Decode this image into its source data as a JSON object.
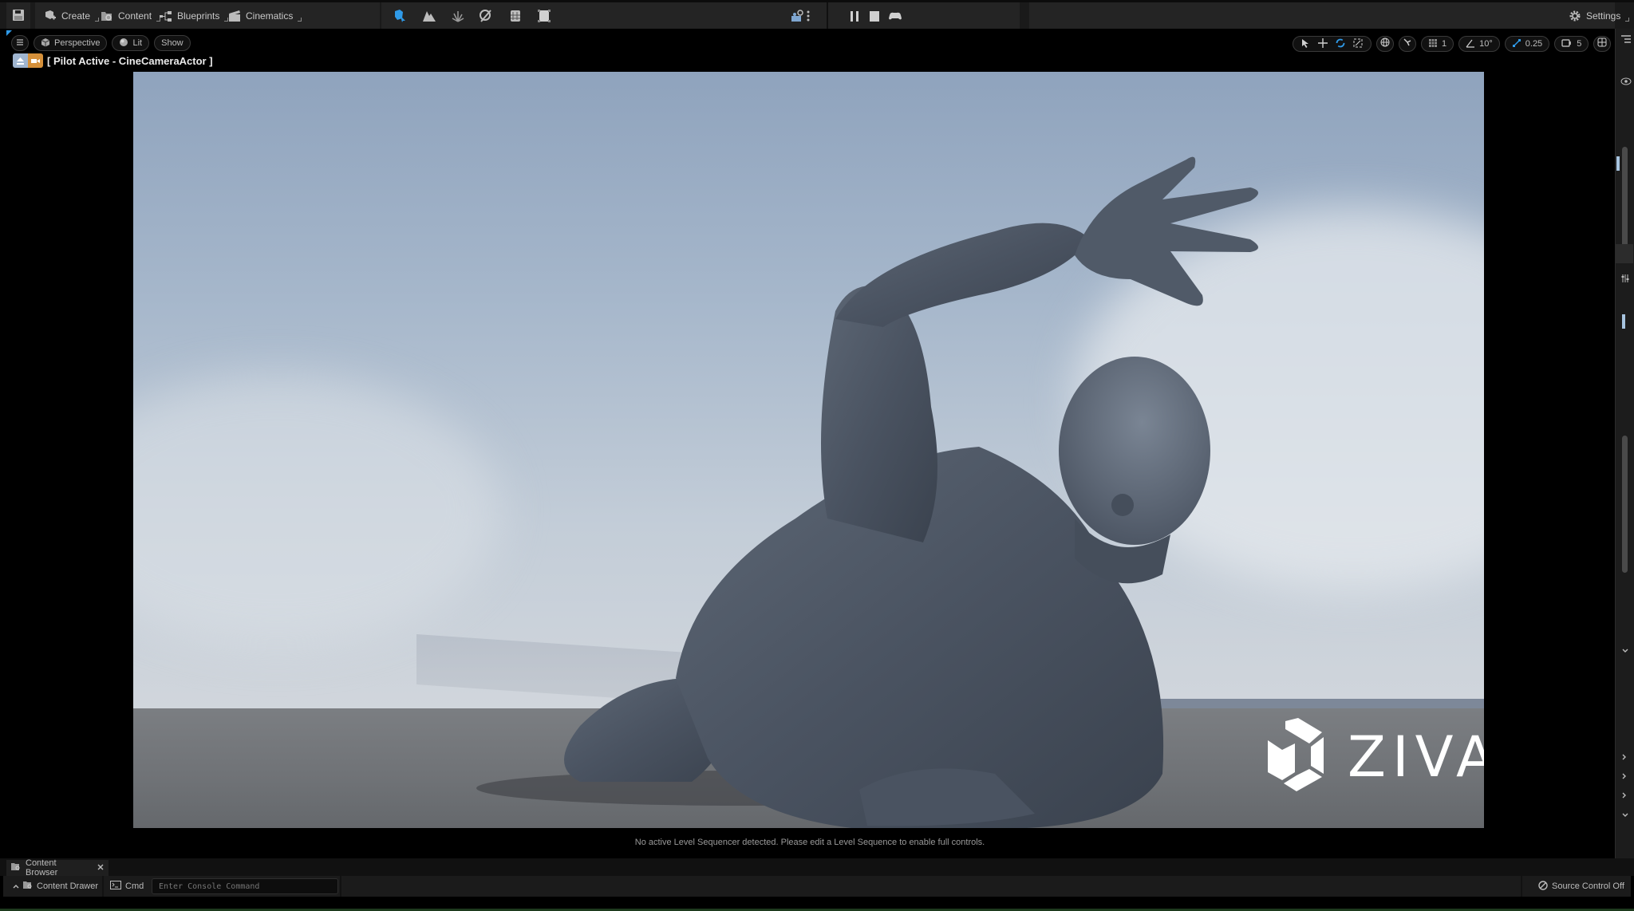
{
  "toolbar": {
    "save_icon": "save-icon",
    "menus": [
      {
        "label": "Create",
        "icon": "create-icon"
      },
      {
        "label": "Content",
        "icon": "content-icon"
      },
      {
        "label": "Blueprints",
        "icon": "blueprints-icon"
      },
      {
        "label": "Cinematics",
        "icon": "cinematics-icon"
      }
    ],
    "modes": [
      "select-mode-icon",
      "landscape-mode-icon",
      "foliage-mode-icon",
      "mesh-paint-mode-icon",
      "fracture-mode-icon",
      "modeling-mode-icon"
    ],
    "platform_icon": "platforms-icon",
    "play_controls": [
      "pause-icon",
      "stop-icon",
      "possess-gamepad-icon"
    ],
    "settings_label": "Settings",
    "accent": "#2f9ae8"
  },
  "viewport": {
    "menu_icon": "hamburger-icon",
    "view_mode_label": "Perspective",
    "lighting_label": "Lit",
    "show_label": "Show",
    "pilot_label": "[ Pilot Active - CineCameraActor ]",
    "pilot_color": "#d5903a",
    "grid_snap_value": "1",
    "rotation_snap_value": "10°",
    "scale_snap_value": "0.25",
    "camera_speed_value": "5",
    "overlay_logo_text": "ZIVA",
    "sequencer_message": "No active Level Sequencer detected. Please edit a Level Sequence to enable full controls."
  },
  "bottom": {
    "content_browser_tab": "Content Browser",
    "content_drawer_label": "Content Drawer",
    "cmd_label": "Cmd",
    "console_placeholder": "Enter Console Command",
    "source_control_label": "Source Control Off"
  }
}
